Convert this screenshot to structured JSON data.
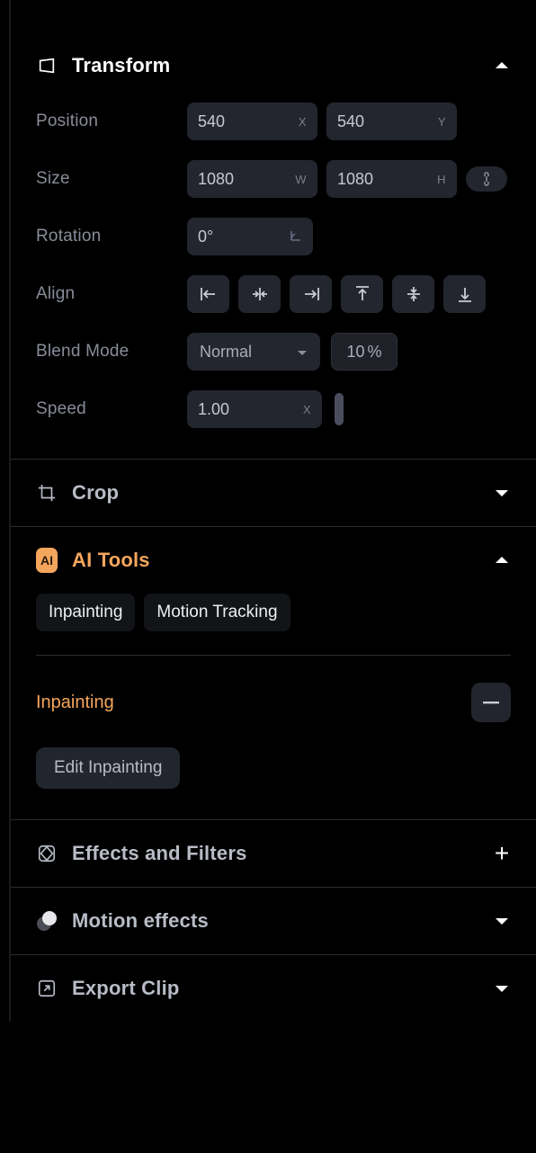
{
  "sections": {
    "transform": {
      "title": "Transform",
      "position": {
        "label": "Position",
        "x": "540",
        "y": "540"
      },
      "size": {
        "label": "Size",
        "w": "1080",
        "h": "1080"
      },
      "rotation": {
        "label": "Rotation",
        "value": "0°"
      },
      "align": {
        "label": "Align"
      },
      "blend": {
        "label": "Blend Mode",
        "mode": "Normal",
        "opacity": "10"
      },
      "speed": {
        "label": "Speed",
        "value": "1.00"
      }
    },
    "crop": {
      "title": "Crop"
    },
    "ai_tools": {
      "badge": "AI",
      "title": "AI Tools",
      "chips": {
        "inpainting": "Inpainting",
        "motion_tracking": "Motion Tracking"
      },
      "inpainting": {
        "label": "Inpainting",
        "edit_label": "Edit Inpainting"
      }
    },
    "effects": {
      "title": "Effects and Filters"
    },
    "motion_effects": {
      "title": "Motion effects"
    },
    "export": {
      "title": "Export Clip"
    }
  },
  "suffix": {
    "x": "X",
    "y": "Y",
    "w": "W",
    "h": "H",
    "pct": "%",
    "speed": "X"
  }
}
